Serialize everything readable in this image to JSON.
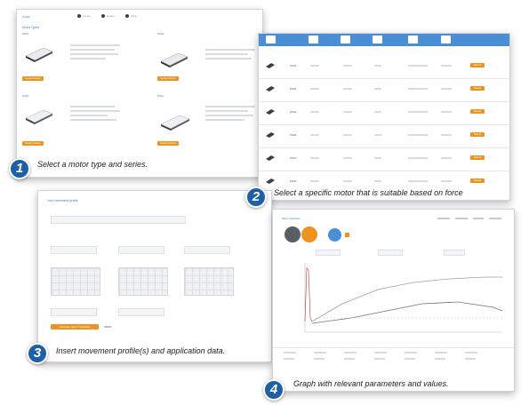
{
  "captions": {
    "step1": "Select a motor type and series.",
    "step2": "Select a specific motor that is suitable based on force",
    "step3": "Insert movement profile(s) and application data.",
    "step4": "Graph with relevant parameters and values."
  },
  "badges": {
    "b1": "1",
    "b2": "2",
    "b3": "3",
    "b4": "4"
  },
  "screen1": {
    "title": "Motor Types",
    "tabs": [
      "Linear",
      "Rotary",
      "Other"
    ],
    "cards": [
      {
        "name": "PS01",
        "button": "Select Series"
      },
      {
        "name": "PS02",
        "button": "Select Series"
      },
      {
        "name": "PS03",
        "button": "Select Series"
      },
      {
        "name": "PS10",
        "button": "Select Series"
      }
    ]
  },
  "screen2": {
    "rows": [
      {
        "model": "PS01",
        "action": "Select"
      },
      {
        "model": "PS02",
        "action": "Select"
      },
      {
        "model": "PS03",
        "action": "Select"
      },
      {
        "model": "PS04",
        "action": "Select"
      },
      {
        "model": "PS10",
        "action": "Select"
      },
      {
        "model": "PS30",
        "action": "Select"
      }
    ]
  },
  "screen3": {
    "title": "Your movement profile",
    "button": "Calculate Motor Suitability"
  },
  "screen4": {
    "title": "Motor Selection"
  },
  "colors": {
    "accent": "#f0921e",
    "header": "#4a8fd6",
    "badge": "#1f5fa8"
  }
}
